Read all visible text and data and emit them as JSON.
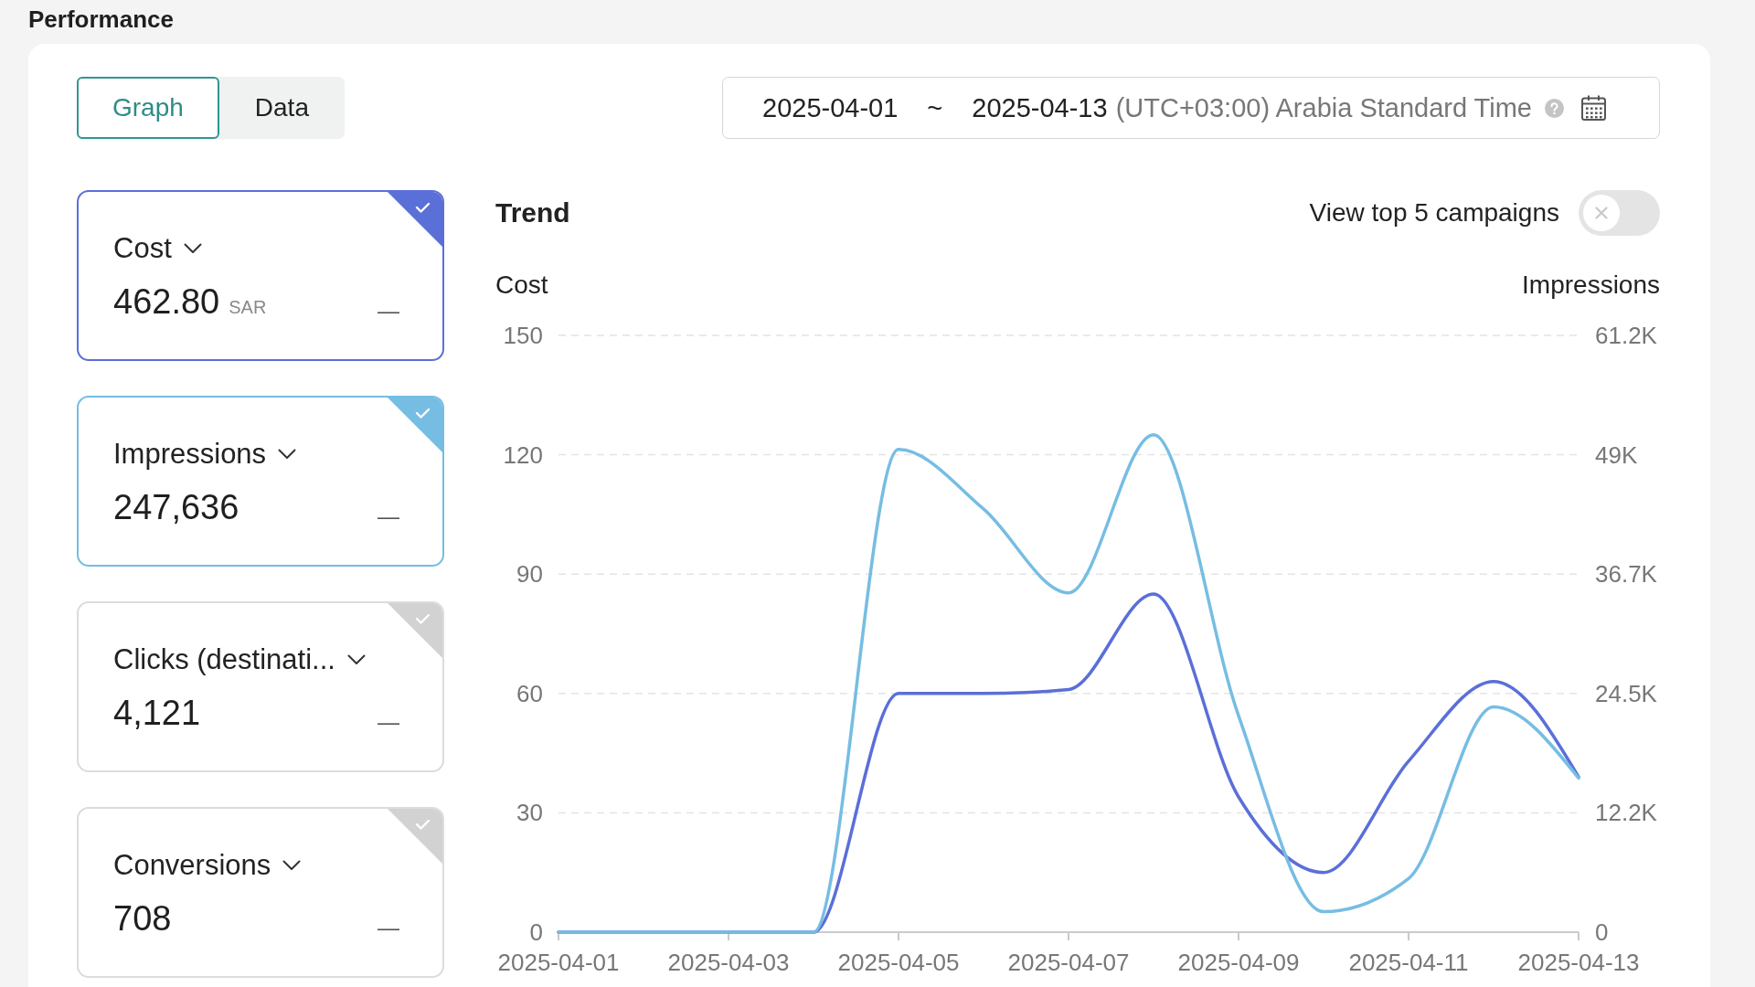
{
  "page_title": "Performance",
  "view_tabs": [
    {
      "label": "Graph",
      "selected": true
    },
    {
      "label": "Data",
      "selected": false
    }
  ],
  "date_range": {
    "start": "2025-04-01",
    "separator": "~",
    "end": "2025-04-13",
    "timezone": "(UTC+03:00) Arabia Standard Time"
  },
  "metrics": [
    {
      "label": "Cost",
      "value": "462.80",
      "unit": "SAR",
      "comparison": "—",
      "selected": true,
      "color": "#5b6fd8"
    },
    {
      "label": "Impressions",
      "value": "247,636",
      "comparison": "—",
      "selected": true,
      "color": "#76bde3"
    },
    {
      "label": "Clicks (destinati...",
      "value": "4,121",
      "comparison": "—",
      "selected": false
    },
    {
      "label": "Conversions",
      "value": "708",
      "comparison": "—",
      "selected": false
    }
  ],
  "trend": {
    "title": "Trend",
    "toggle": {
      "label": "View top 5 campaigns",
      "on": false
    },
    "chart_data": [
      {
        "type": "line",
        "ylabel": "Cost",
        "y2label": "Impressions",
        "categories": [
          "2025-04-01",
          null,
          "2025-04-03",
          null,
          "2025-04-05",
          null,
          "2025-04-07",
          null,
          "2025-04-09",
          null,
          "2025-04-11",
          null,
          "2025-04-13"
        ],
        "series": [
          {
            "color": "#5b6fd8",
            "values": [
              0,
              0,
              0,
              0,
              60,
              60,
              61,
              85,
              34,
              15,
              43,
              63,
              39
            ]
          },
          {
            "color": "#76bde3",
            "axis": "y2",
            "values": [
              0,
              0,
              0,
              0,
              49500,
              43400,
              34800,
              51000,
              22200,
              2100,
              5500,
              23100,
              15800
            ]
          }
        ],
        "ylim": [
          0,
          150
        ],
        "yticks": [
          0,
          30,
          60,
          90,
          120,
          150
        ],
        "y2lim": [
          0,
          61200
        ],
        "y2ticks": [
          {
            "value": 0,
            "label": "0"
          },
          {
            "value": 12240,
            "label": "12.2K"
          },
          {
            "value": 24480,
            "label": "24.5K"
          },
          {
            "value": 36720,
            "label": "36.7K"
          },
          {
            "value": 48960,
            "label": "49K"
          },
          {
            "value": 61200,
            "label": "61.2K"
          }
        ],
        "grid": true
      }
    ]
  }
}
